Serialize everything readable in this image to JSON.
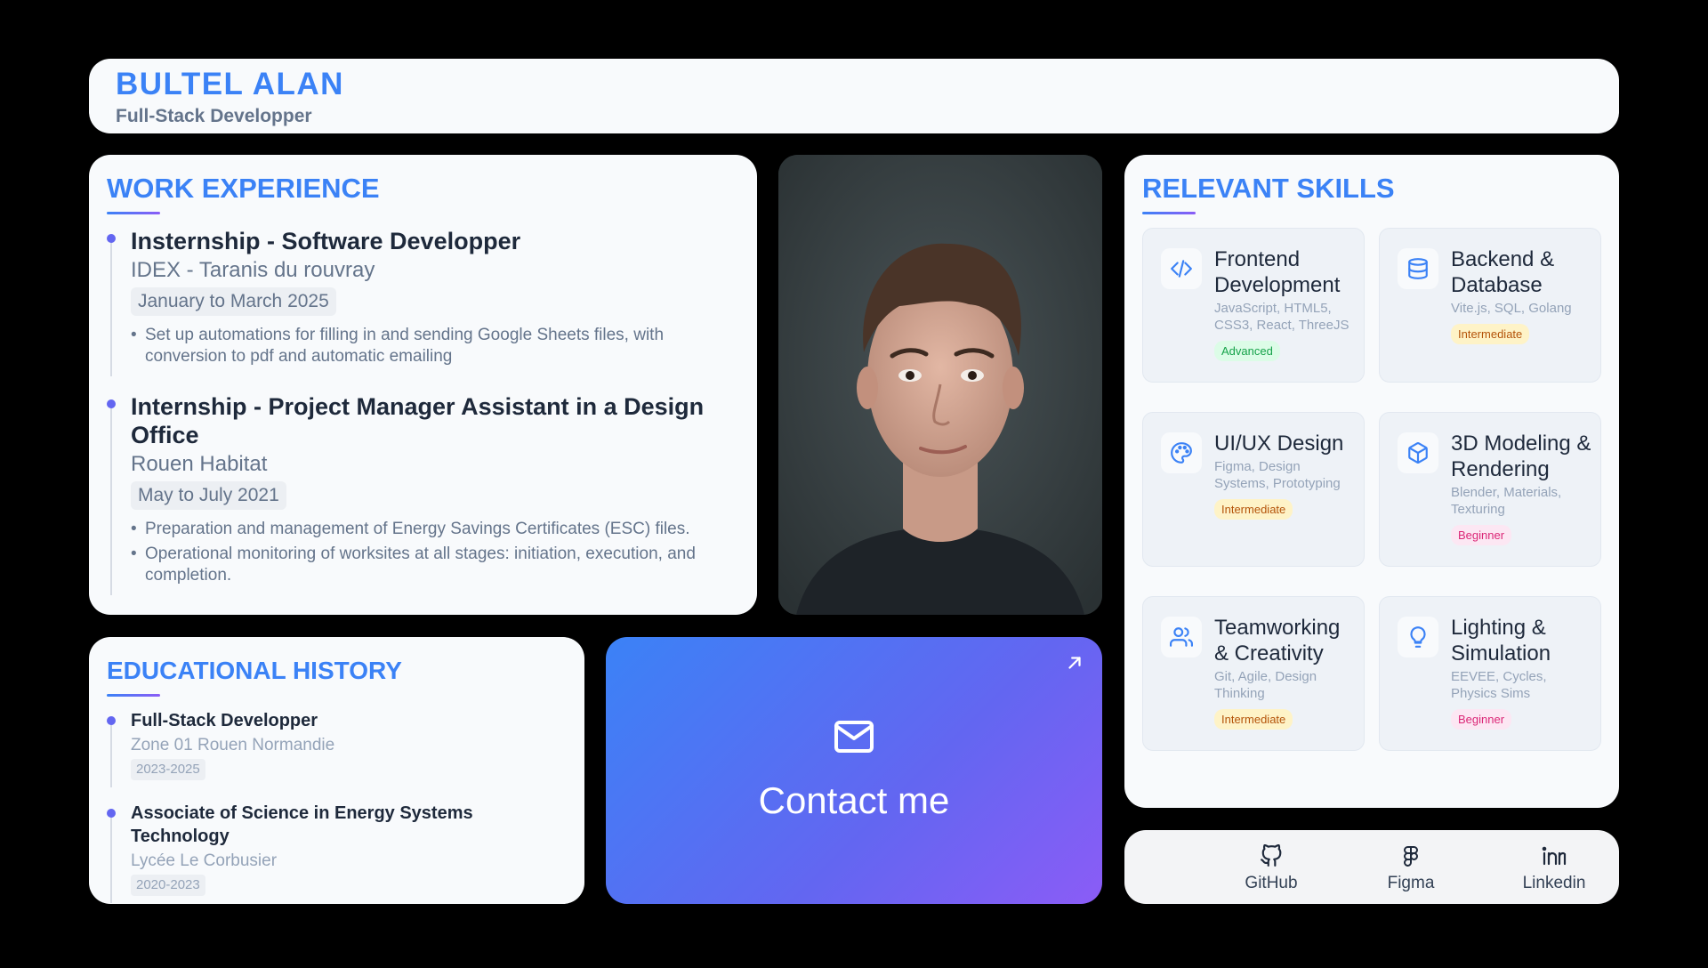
{
  "header": {
    "name": "BULTEL ALAN",
    "role": "Full-Stack Developper"
  },
  "work": {
    "title": "WORK EXPERIENCE",
    "items": [
      {
        "title": "Insternship - Software Developper",
        "org": "IDEX - Taranis du rouvray",
        "date": "January to March 2025",
        "bullets": [
          "Set up automations for filling in and sending Google Sheets files, with conversion to pdf and automatic emailing"
        ]
      },
      {
        "title": "Internship - Project Manager Assistant in a Design Office",
        "org": "Rouen Habitat",
        "date": "May to July 2021",
        "bullets": [
          "Preparation and management of Energy Savings Certificates (ESC) files.",
          "Operational monitoring of worksites at all stages: initiation, execution, and completion."
        ]
      }
    ]
  },
  "skills": {
    "title": "RELEVANT SKILLS",
    "items": [
      {
        "name": "Frontend Development",
        "tech": "JavaScript, HTML5, CSS3, React, ThreeJS",
        "level": "Advanced",
        "icon": "code-icon"
      },
      {
        "name": "Backend & Database",
        "tech": "Vite.js, SQL, Golang",
        "level": "Intermediate",
        "icon": "database-icon"
      },
      {
        "name": "UI/UX Design",
        "tech": "Figma, Design Systems, Prototyping",
        "level": "Intermediate",
        "icon": "palette-icon"
      },
      {
        "name": "3D Modeling & Rendering",
        "tech": "Blender, Materials, Texturing",
        "level": "Beginner",
        "icon": "cube-icon"
      },
      {
        "name": "Teamworking & Creativity",
        "tech": "Git, Agile, Design Thinking",
        "level": "Intermediate",
        "icon": "users-icon"
      },
      {
        "name": "Lighting & Simulation",
        "tech": "EEVEE, Cycles, Physics Sims",
        "level": "Beginner",
        "icon": "lightbulb-icon"
      }
    ]
  },
  "education": {
    "title": "EDUCATIONAL HISTORY",
    "items": [
      {
        "title": "Full-Stack Developper",
        "org": "Zone 01 Rouen Normandie",
        "date": "2023-2025"
      },
      {
        "title": "Associate of Science in Energy Systems Technology",
        "org": "Lycée Le Corbusier",
        "date": "2020-2023"
      }
    ]
  },
  "contact": {
    "label": "Contact me",
    "icon": "mail-icon",
    "arrow_icon": "arrow-up-right-icon"
  },
  "social": [
    {
      "label": "GitHub",
      "icon": "github-icon"
    },
    {
      "label": "Figma",
      "icon": "figma-icon"
    },
    {
      "label": "Linkedin",
      "icon": "linkedin-icon"
    }
  ],
  "colors": {
    "accent": "#3b82f6",
    "accent_purple": "#8b5cf6",
    "card_bg": "#f8fafc",
    "page_bg": "#000000",
    "advanced": "#16a34a",
    "intermediate": "#b45309",
    "beginner": "#db2777"
  }
}
